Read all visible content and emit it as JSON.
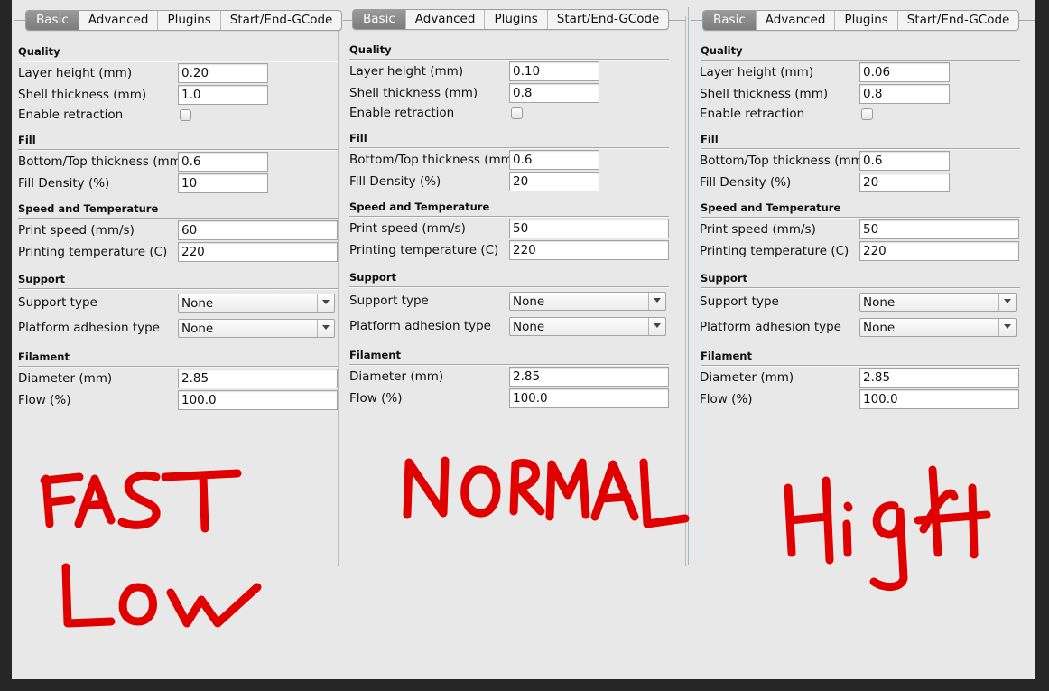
{
  "tabs": [
    "Basic",
    "Advanced",
    "Plugins",
    "Start/End-GCode"
  ],
  "sections": {
    "quality": "Quality",
    "fill": "Fill",
    "speed": "Speed and Temperature",
    "support": "Support",
    "filament": "Filament"
  },
  "labels": {
    "layer_height": "Layer height (mm)",
    "shell_thickness": "Shell thickness (mm)",
    "enable_retraction": "Enable retraction",
    "bottom_top_thickness": "Bottom/Top thickness (mm)",
    "fill_density": "Fill Density (%)",
    "print_speed": "Print speed (mm/s)",
    "printing_temperature": "Printing temperature (C)",
    "support_type": "Support type",
    "platform_adhesion": "Platform adhesion type",
    "diameter": "Diameter (mm)",
    "flow": "Flow (%)"
  },
  "panels": [
    {
      "layer_height": "0.20",
      "shell_thickness": "1.0",
      "enable_retraction": false,
      "bottom_top_thickness": "0.6",
      "fill_density": "10",
      "print_speed": "60",
      "printing_temperature": "220",
      "support_type": "None",
      "platform_adhesion": "None",
      "diameter": "2.85",
      "flow": "100.0"
    },
    {
      "layer_height": "0.10",
      "shell_thickness": "0.8",
      "enable_retraction": false,
      "bottom_top_thickness": "0.6",
      "fill_density": "20",
      "print_speed": "50",
      "printing_temperature": "220",
      "support_type": "None",
      "platform_adhesion": "None",
      "diameter": "2.85",
      "flow": "100.0"
    },
    {
      "layer_height": "0.06",
      "shell_thickness": "0.8",
      "enable_retraction": false,
      "bottom_top_thickness": "0.6",
      "fill_density": "20",
      "print_speed": "50",
      "printing_temperature": "220",
      "support_type": "None",
      "platform_adhesion": "None",
      "diameter": "2.85",
      "flow": "100.0"
    }
  ],
  "annotations": [
    "FAST",
    "Low",
    "NORMAL",
    "High"
  ],
  "colors": {
    "annotation": "#e10000",
    "active_tab": "#8a8a8a",
    "canvas": "#e8e8e8"
  }
}
